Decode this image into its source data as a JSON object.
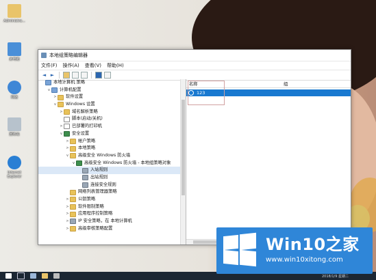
{
  "desktop": {
    "icons": [
      {
        "label": "Administra...",
        "icon": "user-folder-icon",
        "color": "#e9c46a"
      },
      {
        "label": "此电脑",
        "icon": "computer-icon",
        "color": "#4a8fd8"
      },
      {
        "label": "网络",
        "icon": "network-icon",
        "color": "#3f87d6"
      },
      {
        "label": "回收站",
        "icon": "recycle-bin-icon",
        "color": "#b7c2cc"
      },
      {
        "label": "Internet Explorer",
        "icon": "ie-icon",
        "color": "#2a7fd4"
      }
    ]
  },
  "window": {
    "title": "本地组策略编辑器",
    "menu": [
      "文件(F)",
      "操作(A)",
      "查看(V)",
      "帮助(H)"
    ],
    "toolbar": {
      "back": "◄",
      "forward": "►"
    },
    "tree": [
      {
        "label": "本地计算机 策略",
        "level": 0,
        "toggle": "",
        "icon": "pc"
      },
      {
        "label": "计算机配置",
        "level": 1,
        "toggle": "v",
        "icon": "pc"
      },
      {
        "label": "软件设置",
        "level": 2,
        "toggle": ">",
        "icon": "folder"
      },
      {
        "label": "Windows 设置",
        "level": 2,
        "toggle": "v",
        "icon": "folder"
      },
      {
        "label": "域名解析策略",
        "level": 3,
        "toggle": ">",
        "icon": "folder"
      },
      {
        "label": "脚本(启动/关机)",
        "level": 3,
        "toggle": "",
        "icon": "doc"
      },
      {
        "label": "已部署的打印机",
        "level": 3,
        "toggle": ">",
        "icon": "doc"
      },
      {
        "label": "安全设置",
        "level": 3,
        "toggle": "v",
        "icon": "shield"
      },
      {
        "label": "帐户策略",
        "level": 4,
        "toggle": ">",
        "icon": "folder"
      },
      {
        "label": "本地策略",
        "level": 4,
        "toggle": ">",
        "icon": "folder"
      },
      {
        "label": "高级安全 Windows 防火墙",
        "level": 4,
        "toggle": "v",
        "icon": "folder"
      },
      {
        "label": "高级安全 Windows 防火墙 - 本地组策略对象",
        "level": 5,
        "toggle": "v",
        "icon": "shield"
      },
      {
        "label": "入站规则",
        "level": 6,
        "toggle": "",
        "icon": "gear",
        "selected": true
      },
      {
        "label": "出站规则",
        "level": 6,
        "toggle": "",
        "icon": "gear"
      },
      {
        "label": "连接安全规则",
        "level": 6,
        "toggle": "",
        "icon": "gear"
      },
      {
        "label": "网络列表管理器策略",
        "level": 4,
        "toggle": "",
        "icon": "folder"
      },
      {
        "label": "公钥策略",
        "level": 4,
        "toggle": ">",
        "icon": "folder"
      },
      {
        "label": "软件限制策略",
        "level": 4,
        "toggle": ">",
        "icon": "folder"
      },
      {
        "label": "应用程序控制策略",
        "level": 4,
        "toggle": ">",
        "icon": "folder"
      },
      {
        "label": "IP 安全策略，在 本地计算机",
        "level": 4,
        "toggle": ">",
        "icon": "gear"
      },
      {
        "label": "高级审核策略配置",
        "level": 4,
        "toggle": ">",
        "icon": "folder"
      }
    ],
    "list": {
      "headers": [
        "名称",
        "组"
      ],
      "rows": [
        {
          "name": "123"
        }
      ]
    }
  },
  "taskbar": {
    "clock": "2018/1/9 星期二"
  },
  "watermark": {
    "brand": "Win10之家",
    "site": "www.win10xitong.com",
    "color": "#2f86d8"
  }
}
